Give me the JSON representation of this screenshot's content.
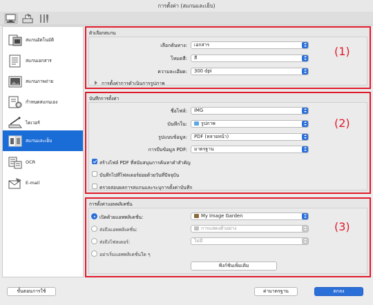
{
  "window": {
    "title": "การตั้งค่า (สแกนและเย็บ)"
  },
  "sidebar": {
    "items": [
      {
        "label": "สแกนอัตโนมัติ",
        "icon": "auto-scan-icon"
      },
      {
        "label": "สแกนเอกสาร",
        "icon": "document-scan-icon"
      },
      {
        "label": "สแกนภาพถ่าย",
        "icon": "photo-scan-icon"
      },
      {
        "label": "กำหนดสแกนเอง",
        "icon": "custom-scan-icon"
      },
      {
        "label": "ไดเวอร์",
        "icon": "driver-icon"
      },
      {
        "label": "สแกนและเย็บ",
        "icon": "scan-and-stitch-icon"
      },
      {
        "label": "OCR",
        "icon": "ocr-icon"
      },
      {
        "label": "E-mail",
        "icon": "email-icon"
      }
    ]
  },
  "scan_options": {
    "title": "ตัวเลือกสแกน",
    "source_label": "เลือกต้นทาง:",
    "source_value": "เอกสาร",
    "color_label": "โหมดสี:",
    "color_value": "สี",
    "resolution_label": "ความละเอียด:",
    "resolution_value": "300 dpi",
    "image_processing_label": "การตั้งค่าการดำเนินการรูปภาพ"
  },
  "save_settings": {
    "title": "บันทึกการตั้งค่า",
    "filename_label": "ชื่อไฟล์:",
    "filename_value": "IMG",
    "save_in_label": "บันทึกใน:",
    "save_in_value": "รูปภาพ",
    "format_label": "รูปแบบข้อมูล:",
    "format_value": "PDF (หลายหน้า)",
    "compression_label": "การบีบข้อมูล PDF:",
    "compression_value": "มาตรฐาน",
    "cb1": "สร้างไฟล์ PDF ที่สนับสนุนการค้นหาคำสำคัญ",
    "cb2": "บันทึกไปที่โฟลเดอร์ย่อยด้วยวันที่ปัจจุบัน",
    "cb3": "ตรวจสอบผลการสแกนและระบุการตั้งค่าบันทึก"
  },
  "app_settings": {
    "title": "การตั้งค่าแอพพลิเคชั่น",
    "r1_label": "เปิดด้วยแอพพลิเคชั่น:",
    "r1_value": "My Image Garden",
    "r2_label": "ส่งถึงแอพพลิเคชั่น:",
    "r2_value": "การแสดงตัวอย่าง",
    "r3_label": "ส่งถึงโฟลเดอร์:",
    "r3_value": "ไม่มี",
    "r4_label": "อย่าเริ่มแอพพลิเคชั่นใด ๆ",
    "more_functions": "ฟังก์ชันเพิ่มเติม"
  },
  "callouts": [
    "(1)",
    "(2)",
    "(3)"
  ],
  "footer": {
    "instructions": "ขั้นตอนการใช้",
    "defaults": "ค่ามาตรฐาน",
    "ok": "ตกลง"
  },
  "colors": {
    "accent": "#2b6fd8",
    "callout": "#e0192a",
    "selected": "#1a6cd6"
  }
}
